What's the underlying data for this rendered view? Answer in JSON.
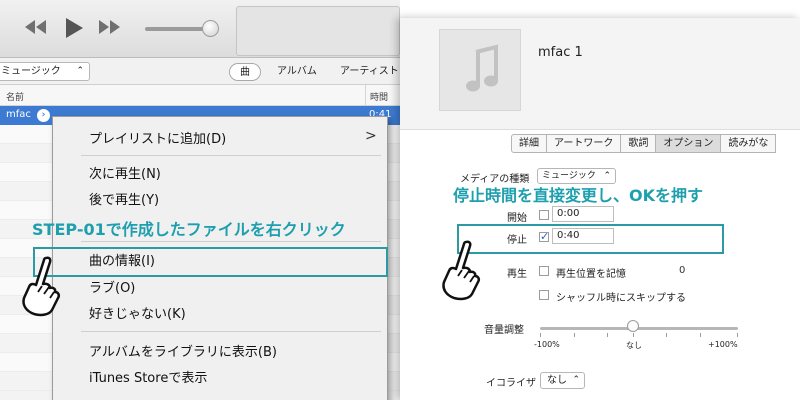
{
  "itunes": {
    "library_select": "ミュージック",
    "segments": [
      "曲",
      "アルバム",
      "アーティスト"
    ],
    "columns": {
      "name": "名前",
      "time": "時間"
    },
    "track": {
      "name": "mfac",
      "time": "0:41"
    }
  },
  "context_menu": {
    "items": [
      "プレイリストに追加(D)",
      "次に再生(N)",
      "後で再生(Y)",
      "曲の情報(I)",
      "ラブ(O)",
      "好きじゃない(K)",
      "アルバムをライブラリに表示(B)",
      "iTunes Storeで表示"
    ],
    "submenu_chevron": ">"
  },
  "info_dialog": {
    "title": "mfac 1",
    "tabs": [
      "詳細",
      "アートワーク",
      "歌詞",
      "オプション",
      "読みがな"
    ],
    "active_tab": "オプション",
    "media_kind_label": "メディアの種類",
    "media_kind_value": "ミュージック",
    "start_label": "開始",
    "start_value": "0:00",
    "start_checked": false,
    "stop_label": "停止",
    "stop_value": "0:40",
    "stop_checked": true,
    "playback_label": "再生",
    "remember_position": "再生位置を記憶",
    "skip_shuffle": "シャッフル時にスキップする",
    "volume_label": "音量調整",
    "volume_min": "-100%",
    "volume_mid": "なし",
    "volume_max": "+100%",
    "volume_adjust_percent": 0,
    "eq_label": "イコライザ",
    "eq_value": "なし"
  },
  "annotations": {
    "step_left": "STEP-01で作成したファイルを右クリック",
    "step_right": "停止時間を直接変更し、OKを押す",
    "stray_mark": "0"
  },
  "colors": {
    "accent": "#1e9fae",
    "selection": "#3d7bd2"
  }
}
